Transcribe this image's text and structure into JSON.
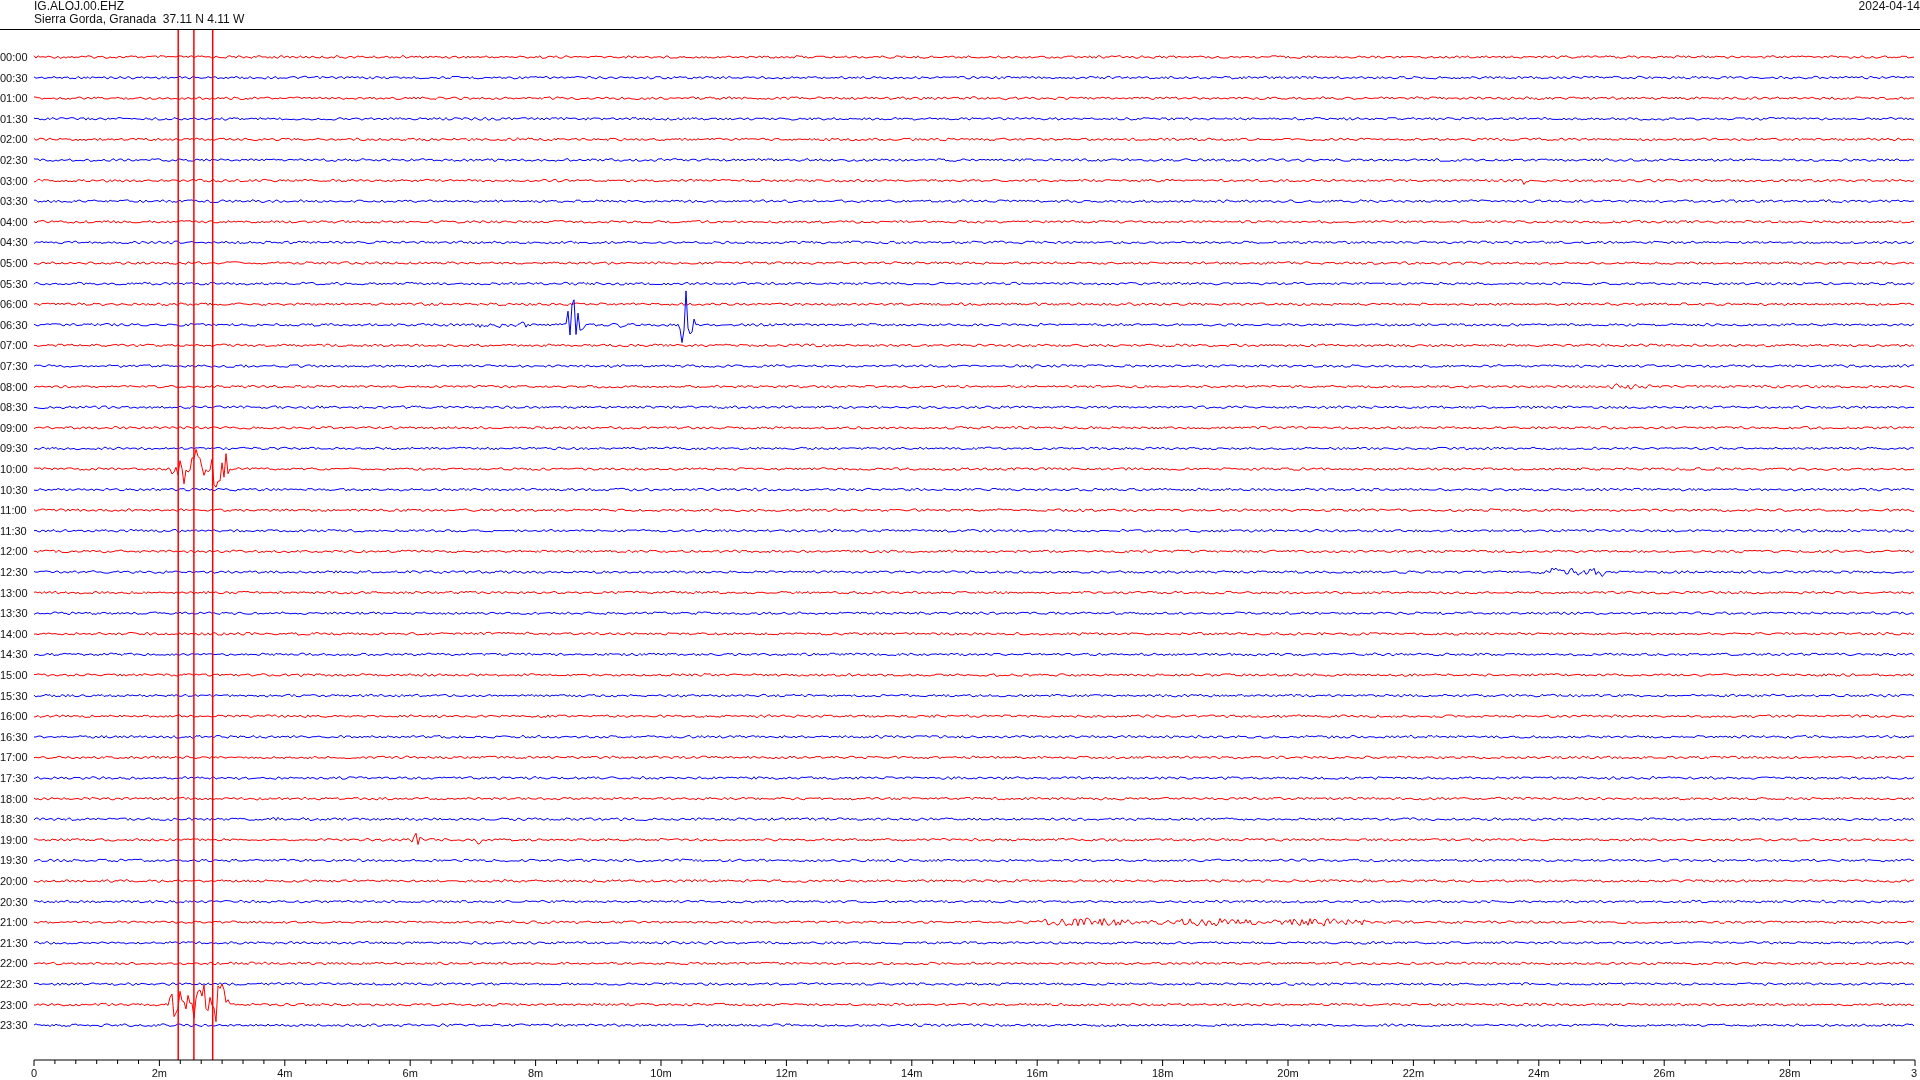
{
  "header": {
    "station": "IG.ALOJ.00.EHZ",
    "location": "Sierra Gorda, Granada  37.11 N 4.11 W",
    "date": "2024-04-14"
  },
  "helicorder": {
    "rows": [
      {
        "label": "00:00",
        "color": "#ff0000"
      },
      {
        "label": "00:30",
        "color": "#0000ff"
      },
      {
        "label": "01:00",
        "color": "#ff0000"
      },
      {
        "label": "01:30",
        "color": "#0000ff"
      },
      {
        "label": "02:00",
        "color": "#ff0000"
      },
      {
        "label": "02:30",
        "color": "#0000ff"
      },
      {
        "label": "03:00",
        "color": "#ff0000"
      },
      {
        "label": "03:30",
        "color": "#0000ff"
      },
      {
        "label": "04:00",
        "color": "#ff0000"
      },
      {
        "label": "04:30",
        "color": "#0000ff"
      },
      {
        "label": "05:00",
        "color": "#ff0000"
      },
      {
        "label": "05:30",
        "color": "#0000ff"
      },
      {
        "label": "06:00",
        "color": "#ff0000"
      },
      {
        "label": "06:30",
        "color": "#0000ff"
      },
      {
        "label": "07:00",
        "color": "#ff0000"
      },
      {
        "label": "07:30",
        "color": "#0000ff"
      },
      {
        "label": "08:00",
        "color": "#ff0000"
      },
      {
        "label": "08:30",
        "color": "#0000ff"
      },
      {
        "label": "09:00",
        "color": "#ff0000"
      },
      {
        "label": "09:30",
        "color": "#0000ff"
      },
      {
        "label": "10:00",
        "color": "#ff0000"
      },
      {
        "label": "10:30",
        "color": "#0000ff"
      },
      {
        "label": "11:00",
        "color": "#ff0000"
      },
      {
        "label": "11:30",
        "color": "#0000ff"
      },
      {
        "label": "12:00",
        "color": "#ff0000"
      },
      {
        "label": "12:30",
        "color": "#0000ff"
      },
      {
        "label": "13:00",
        "color": "#ff0000"
      },
      {
        "label": "13:30",
        "color": "#0000ff"
      },
      {
        "label": "14:00",
        "color": "#ff0000"
      },
      {
        "label": "14:30",
        "color": "#0000ff"
      },
      {
        "label": "15:00",
        "color": "#ff0000"
      },
      {
        "label": "15:30",
        "color": "#0000ff"
      },
      {
        "label": "16:00",
        "color": "#ff0000"
      },
      {
        "label": "16:30",
        "color": "#0000ff"
      },
      {
        "label": "17:00",
        "color": "#ff0000"
      },
      {
        "label": "17:30",
        "color": "#0000ff"
      },
      {
        "label": "18:00",
        "color": "#ff0000"
      },
      {
        "label": "18:30",
        "color": "#0000ff"
      },
      {
        "label": "19:00",
        "color": "#ff0000"
      },
      {
        "label": "19:30",
        "color": "#0000ff"
      },
      {
        "label": "20:00",
        "color": "#ff0000"
      },
      {
        "label": "20:30",
        "color": "#0000ff"
      },
      {
        "label": "21:00",
        "color": "#ff0000"
      },
      {
        "label": "21:30",
        "color": "#0000ff"
      },
      {
        "label": "22:00",
        "color": "#ff0000"
      },
      {
        "label": "22:30",
        "color": "#0000ff"
      },
      {
        "label": "23:00",
        "color": "#ff0000"
      },
      {
        "label": "23:30",
        "color": "#0000ff"
      }
    ],
    "x_ticks": [
      "0",
      "2m",
      "4m",
      "6m",
      "8m",
      "10m",
      "12m",
      "14m",
      "16m",
      "18m",
      "20m",
      "22m",
      "24m",
      "26m",
      "28m",
      "3"
    ]
  }
}
